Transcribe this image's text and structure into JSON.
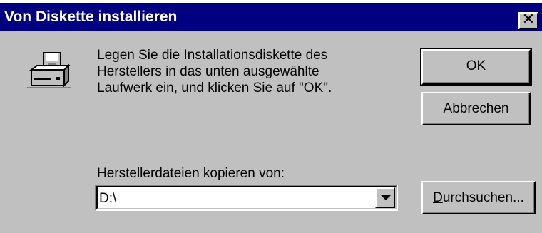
{
  "dialog": {
    "title": "Von Diskette installieren",
    "close_symbol": "✕"
  },
  "icon": {
    "name": "floppy-drive-icon"
  },
  "message": {
    "lines": [
      "Legen Sie die Installationsdiskette des",
      "Herstellers in das unten ausgewählte",
      "Laufwerk ein, und klicken Sie auf \"OK\"."
    ]
  },
  "buttons": {
    "ok": "OK",
    "cancel": "Abbrechen",
    "browse_accel": "D",
    "browse_rest": "urchsuchen..."
  },
  "copy_from": {
    "label": "Herstellerdateien kopieren von:",
    "value": "D:\\"
  },
  "colors": {
    "titlebar": "#000080",
    "face": "#c0c0c0"
  }
}
